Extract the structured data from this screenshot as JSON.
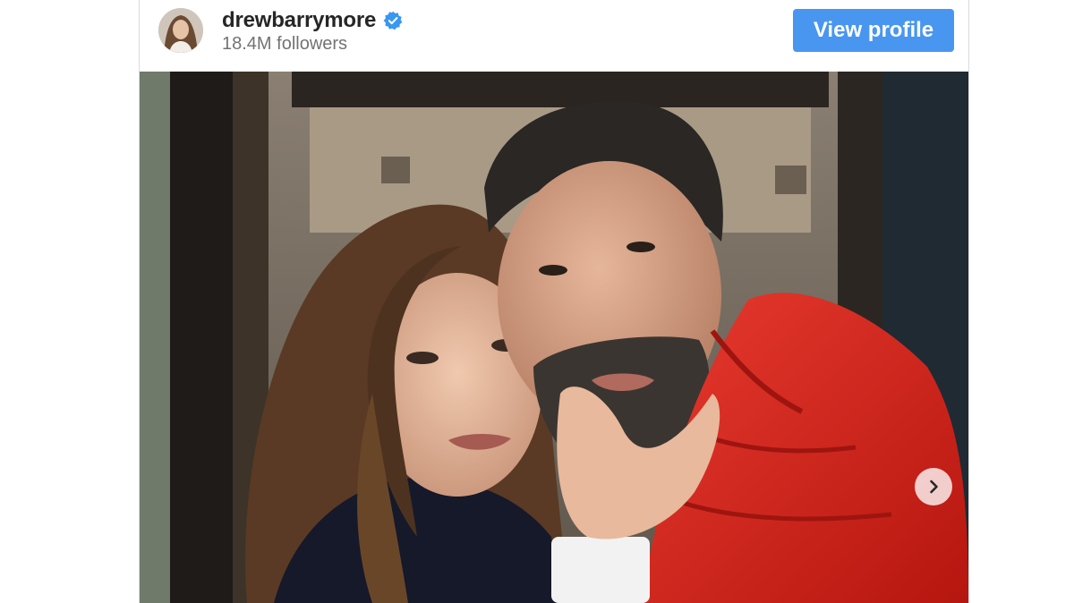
{
  "profile": {
    "username": "drewbarrymore",
    "followers": "18.4M followers",
    "verified_icon": "verified-badge-icon",
    "avatar_icon": "profile-avatar"
  },
  "actions": {
    "view_profile_label": "View profile",
    "next_icon": "chevron-right-icon"
  },
  "post": {
    "media_type": "photo"
  },
  "colors": {
    "button_blue": "#4896f0",
    "verified_blue": "#3897f0",
    "username_text": "#262626",
    "followers_text": "#737373",
    "jacket_red": "#d8221c"
  }
}
